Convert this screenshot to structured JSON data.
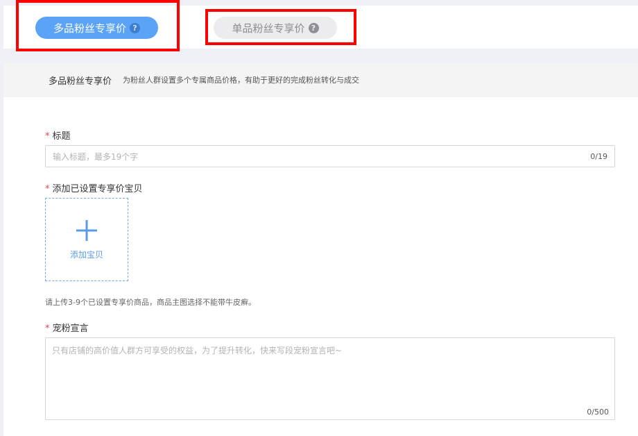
{
  "tabs": [
    {
      "label": "多品粉丝专享价",
      "help": "?",
      "active": true
    },
    {
      "label": "单品粉丝专享价",
      "help": "?",
      "active": false
    }
  ],
  "info": {
    "title": "多品粉丝专享价",
    "description": "为粉丝人群设置多个专属商品价格，有助于更好的完成粉丝转化与成交"
  },
  "form": {
    "required_mark": "*",
    "title_label": "标题",
    "title_placeholder": "输入标题，最多19个字",
    "title_counter": "0/19",
    "add_label": "添加已设置专享价宝贝",
    "add_button": "添加宝贝",
    "hint": "请上传3-9个已设置专享价商品，商品主图选择不能带牛皮癣。",
    "slogan_label": "宠粉宣言",
    "slogan_placeholder": "只有店铺的高价值人群方可享受的权益，为了提升转化，快来写段宠粉宣言吧~",
    "slogan_counter": "0/500"
  },
  "colors": {
    "accent": "#5ba3f7",
    "required": "#e0484f",
    "highlight": "#ff0000"
  },
  "icons": {
    "help": "question-circle-icon",
    "add": "plus-icon"
  }
}
